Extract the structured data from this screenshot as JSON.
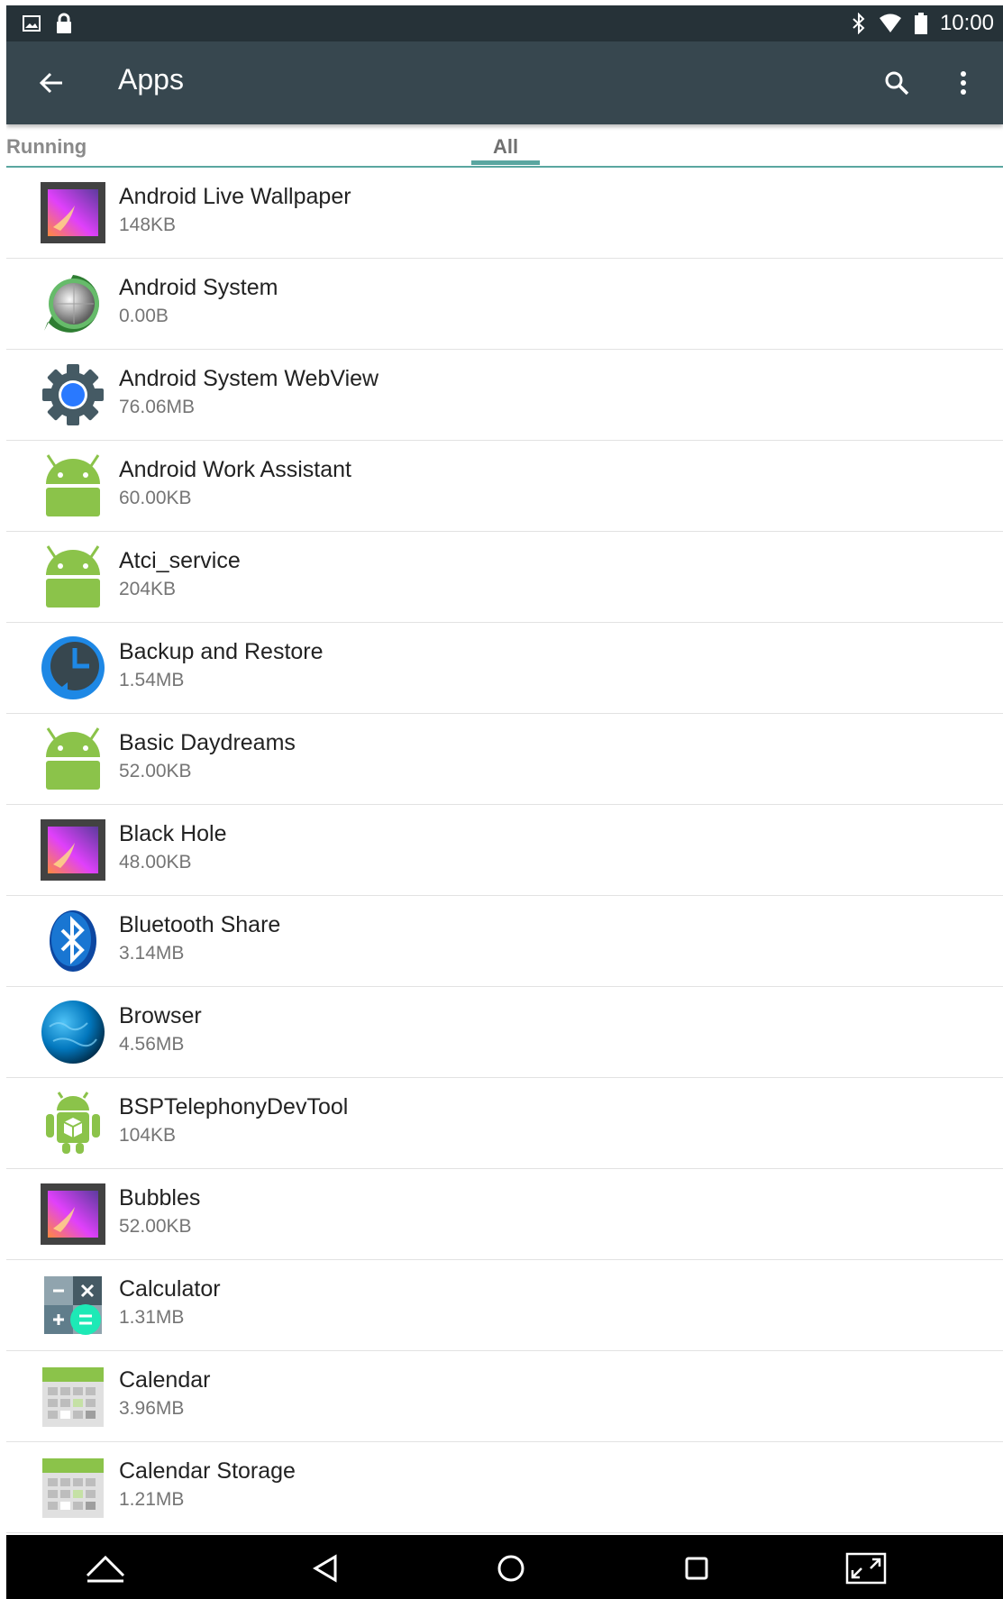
{
  "status_bar": {
    "time": "10:00",
    "icons": [
      "image-notification-icon",
      "lock-icon",
      "bluetooth-icon",
      "wifi-icon",
      "battery-icon"
    ]
  },
  "app_bar": {
    "title": "Apps",
    "icons": [
      "back-arrow-icon",
      "search-icon",
      "more-vert-icon"
    ],
    "color": "#37474f"
  },
  "tabs": [
    {
      "label": "Running",
      "selected": false
    },
    {
      "label": "All",
      "selected": true
    }
  ],
  "accent_color": "#5aa6a0",
  "apps": [
    {
      "name": "Android Live Wallpaper",
      "size": "148KB",
      "icon": "wallpaper-icon"
    },
    {
      "name": "Android System",
      "size": "0.00B",
      "icon": "android-system-icon"
    },
    {
      "name": "Android System WebView",
      "size": "76.06MB",
      "icon": "webview-gear-icon"
    },
    {
      "name": "Android Work Assistant",
      "size": "60.00KB",
      "icon": "android-robot-icon"
    },
    {
      "name": "Atci_service",
      "size": "204KB",
      "icon": "android-robot-icon"
    },
    {
      "name": "Backup and Restore",
      "size": "1.54MB",
      "icon": "backup-clock-icon"
    },
    {
      "name": "Basic Daydreams",
      "size": "52.00KB",
      "icon": "android-robot-icon"
    },
    {
      "name": "Black Hole",
      "size": "48.00KB",
      "icon": "wallpaper-icon"
    },
    {
      "name": "Bluetooth Share",
      "size": "3.14MB",
      "icon": "bluetooth-share-icon"
    },
    {
      "name": "Browser",
      "size": "4.56MB",
      "icon": "browser-globe-icon"
    },
    {
      "name": "BSPTelephonyDevTool",
      "size": "104KB",
      "icon": "android-package-icon"
    },
    {
      "name": "Bubbles",
      "size": "52.00KB",
      "icon": "wallpaper-icon"
    },
    {
      "name": "Calculator",
      "size": "1.31MB",
      "icon": "calculator-icon"
    },
    {
      "name": "Calendar",
      "size": "3.96MB",
      "icon": "calendar-icon"
    },
    {
      "name": "Calendar Storage",
      "size": "1.21MB",
      "icon": "calendar-icon"
    }
  ],
  "nav_bar": {
    "icons": [
      "home-up-arrow-icon",
      "back-triangle-icon",
      "home-circle-icon",
      "recents-square-icon",
      "screenshot-expand-icon"
    ]
  }
}
